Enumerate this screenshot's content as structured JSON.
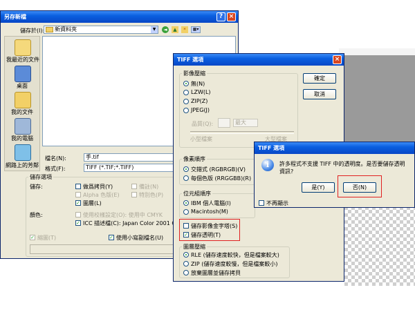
{
  "save_dialog": {
    "title": "另存新檔",
    "save_in_label": "儲存於(I):",
    "save_in_value": "新資料夾",
    "places": [
      {
        "label": "我最近的文件",
        "icon": "recent-docs-icon"
      },
      {
        "label": "桌面",
        "icon": "desktop-icon"
      },
      {
        "label": "我的文件",
        "icon": "my-documents-icon"
      },
      {
        "label": "我的電腦",
        "icon": "my-computer-icon"
      },
      {
        "label": "網路上的芳鄰",
        "icon": "network-places-icon"
      }
    ],
    "filename_label": "檔名(N):",
    "filename_value": "手.tif",
    "format_label": "格式(F):",
    "format_value": "TIFF (*.TIF;*.TIFF)",
    "save_options_title": "儲存選項",
    "save_label": "儲存:",
    "as_copy": "做爲拷貝(Y)",
    "alpha": "Alpha 色版(E)",
    "annotations": "備註(N)",
    "spot_colors": "特別色(P)",
    "layers": "圖層(L)",
    "color_label": "顏色:",
    "proof_setup": "使用校樣設定(O): 使用中 CMYK",
    "icc_profile": "ICC 描述檔(C): Japan Color 2001 Coate",
    "thumbnail": "縮圖(T)",
    "lowercase_ext": "使用小寫副檔名(U)"
  },
  "tiff_options": {
    "title": "TIFF 選項",
    "image_compression_title": "影像壓縮",
    "compression_options": [
      "無(N)",
      "LZW(L)",
      "ZIP(Z)",
      "JPEG(J)"
    ],
    "quality_label": "品質(Q):",
    "quality_select": "最大",
    "small_file": "小型檔案",
    "large_file": "大型檔案",
    "ok_button": "確定",
    "cancel_button": "取消",
    "pixel_order_title": "像素順序",
    "pixel_order_options": [
      "交錯式 (RGBRGB)(V)",
      "每個色版 (RRGGBB)(R)"
    ],
    "byte_order_title": "位元組順序",
    "byte_order_options": [
      "IBM 個人電腦(I)",
      "Macintosh(M)"
    ],
    "save_pyramid": "儲存影像金字塔(S)",
    "save_transparency": "儲存透明(T)",
    "layer_compression_title": "圖層壓縮",
    "layer_compression_options": [
      "RLE (儲存速度較快，但是檔案較大)",
      "ZIP (儲存速度較慢，但是檔案較小)",
      "放棄圖層並儲存拷貝"
    ]
  },
  "alert": {
    "title": "TIFF 選項",
    "message_line1": "許多程式不支援 TIFF 中的透明度。是否要儲存透明",
    "message_line2": "資訊?",
    "yes_button": "是(Y)",
    "no_button": "否(N)",
    "dont_show": "不再顯示"
  }
}
